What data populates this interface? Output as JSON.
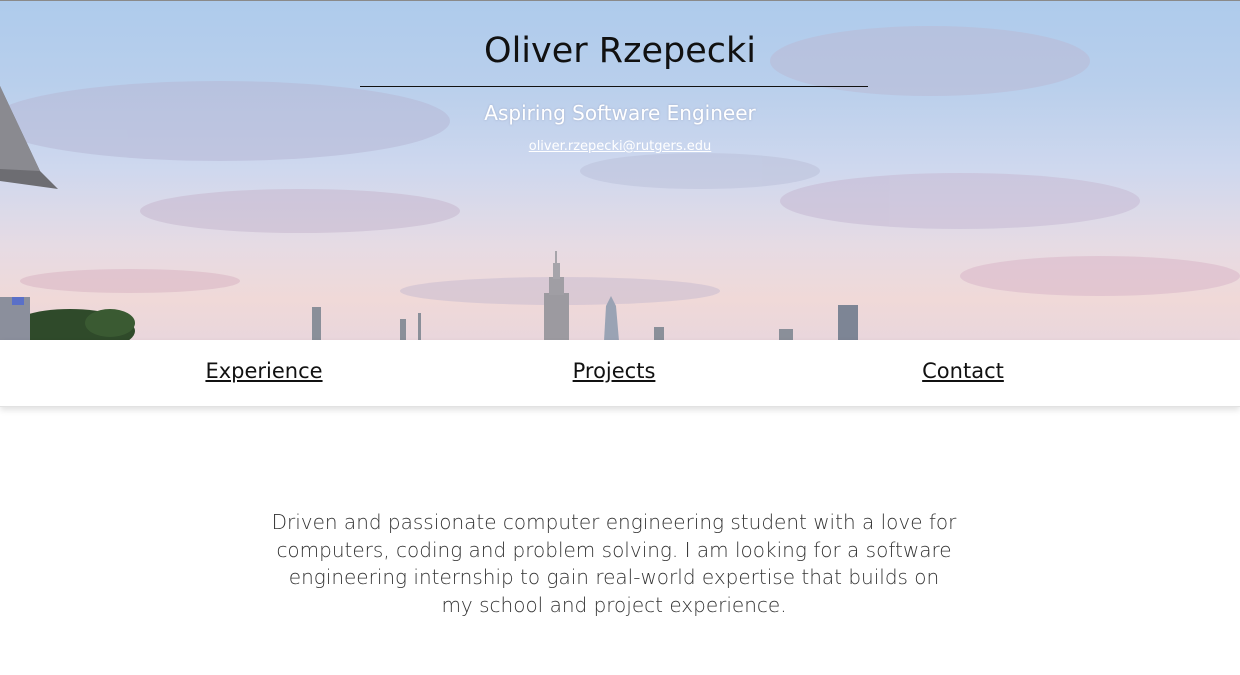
{
  "header": {
    "name": "Oliver Rzepecki",
    "subtitle": "Aspiring Software Engineer",
    "email": "oliver.rzepecki@rutgers.edu",
    "background_image": "city skyline at sunset"
  },
  "nav": {
    "items": [
      {
        "label": "Experience"
      },
      {
        "label": "Projects"
      },
      {
        "label": "Contact"
      }
    ]
  },
  "about": {
    "text": "Driven and passionate computer engineering student with a love for computers, coding and problem solving. I am looking for a software engineering internship to gain real-world expertise that builds on my school and project experience."
  },
  "colors": {
    "sky_top": "#aecbec",
    "sky_bottom": "#f0d9d8",
    "text": "#111111",
    "body_text": "#333333"
  }
}
